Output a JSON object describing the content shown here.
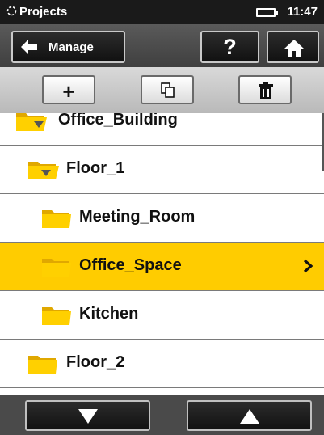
{
  "status": {
    "app_title": "Projects",
    "time": "11:47"
  },
  "toolbar": {
    "manage_label": "Manage",
    "help_label": "?",
    "add_label": "+"
  },
  "tree": [
    {
      "label": "Office_Building",
      "level": 0,
      "open": true,
      "selected": false
    },
    {
      "label": "Floor_1",
      "level": 1,
      "open": true,
      "selected": false
    },
    {
      "label": "Meeting_Room",
      "level": 2,
      "open": false,
      "selected": false
    },
    {
      "label": "Office_Space",
      "level": 2,
      "open": false,
      "selected": true
    },
    {
      "label": "Kitchen",
      "level": 2,
      "open": false,
      "selected": false
    },
    {
      "label": "Floor_2",
      "level": 1,
      "open": false,
      "selected": false
    }
  ],
  "colors": {
    "selection": "#ffcc00",
    "folder": "#f5c400",
    "status_bar": "#1a1a1a"
  },
  "icons": [
    "progress-icon",
    "battery-icon",
    "back-arrow-icon",
    "home-icon",
    "copy-icon",
    "trash-icon",
    "chevron-right-icon",
    "arrow-down-icon",
    "arrow-up-icon",
    "folder-icon",
    "folder-open-icon"
  ]
}
